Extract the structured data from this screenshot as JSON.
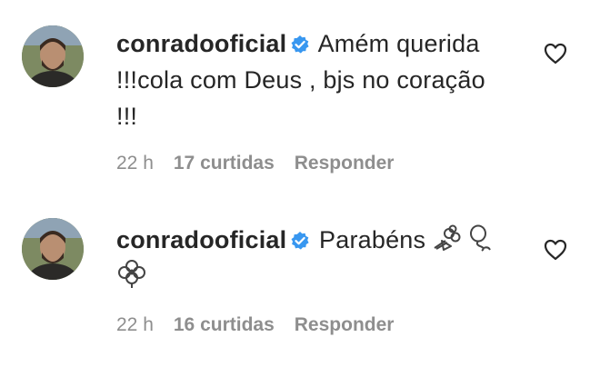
{
  "comments": [
    {
      "username": "conradooficial",
      "verified": true,
      "text_lines": [
        "Amém querida",
        "!!!cola com Deus , bjs no coração",
        "!!!"
      ],
      "emojis": [],
      "time": "22 h",
      "likes": "17 curtidas",
      "reply_label": "Responder"
    },
    {
      "username": "conradooficial",
      "verified": true,
      "text_lines": [
        "Parabéns"
      ],
      "emojis": [
        "bouquet-emoji",
        "balloon-emoji",
        "flower-emoji"
      ],
      "time": "22 h",
      "likes": "16 curtidas",
      "reply_label": "Responder"
    }
  ],
  "colors": {
    "text": "#262626",
    "meta": "#8e8e8e",
    "verified_badge": "#3897f0"
  },
  "icons": {
    "verified": "verified-badge-icon",
    "like": "heart-outline-icon"
  }
}
